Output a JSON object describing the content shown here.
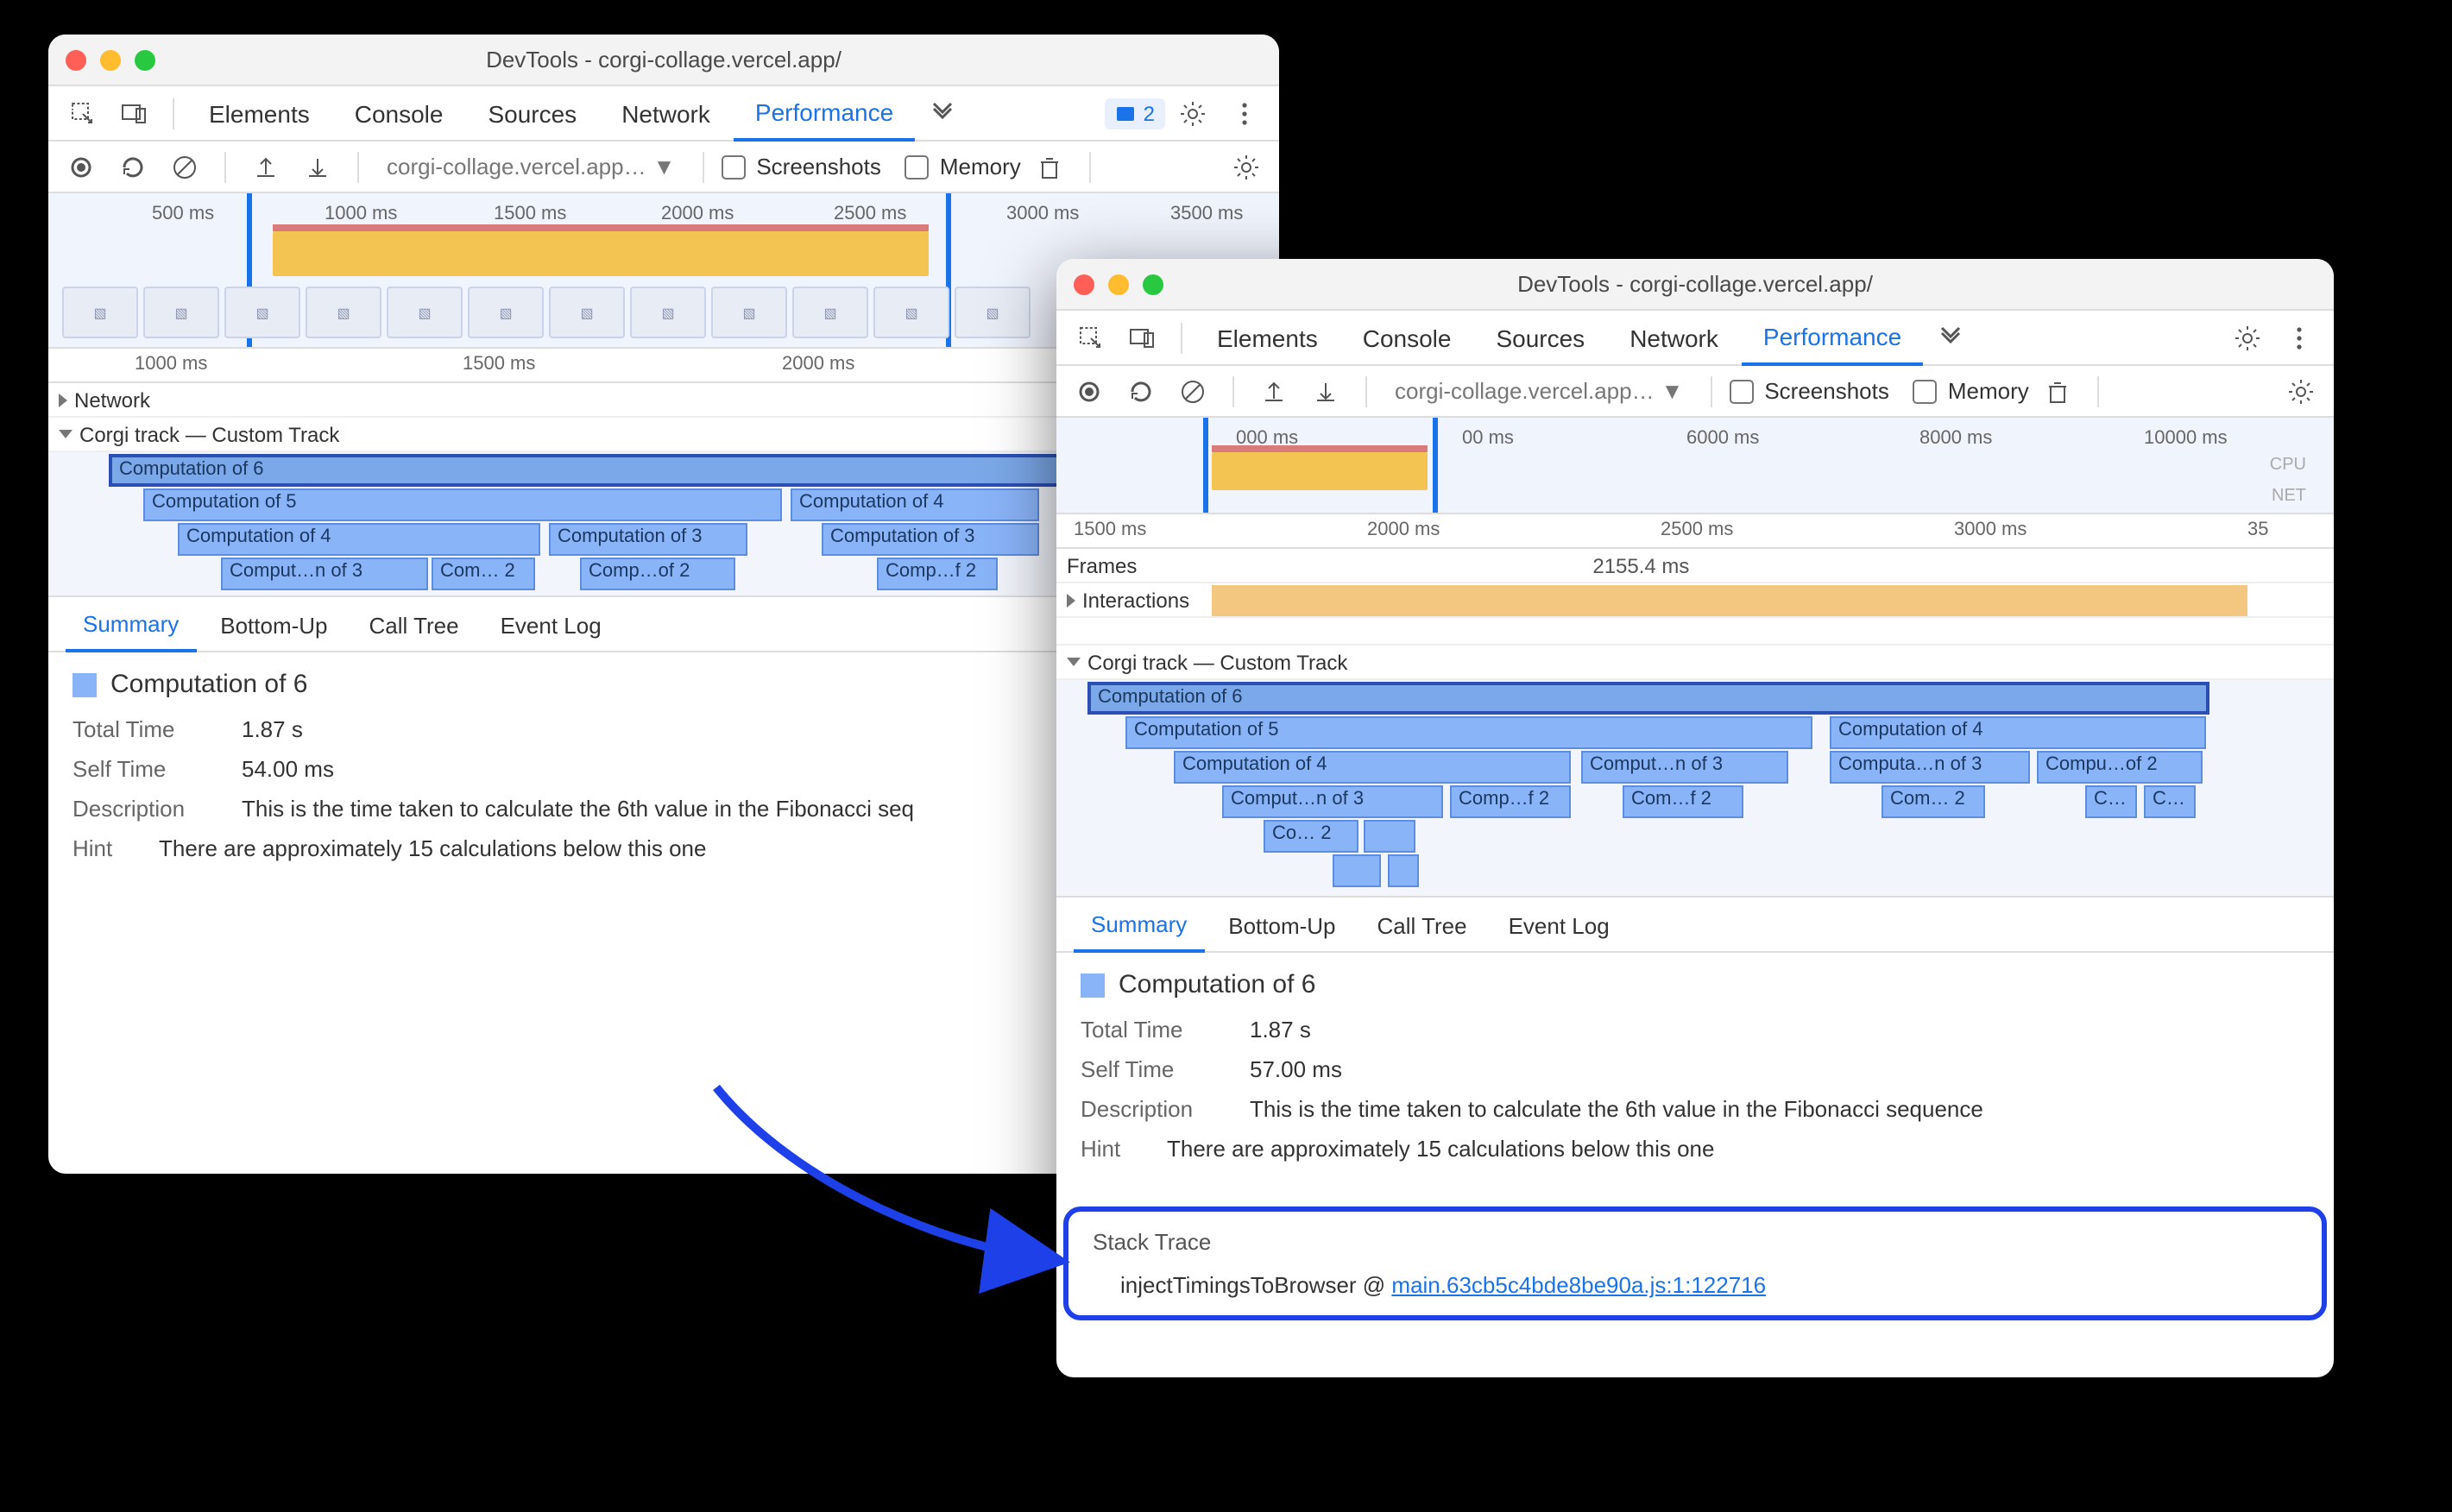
{
  "windowA": {
    "title": "DevTools - corgi-collage.vercel.app/",
    "tabs": [
      "Elements",
      "Console",
      "Sources",
      "Network",
      "Performance"
    ],
    "active_tab": "Performance",
    "issue_count": "2",
    "toolbar": {
      "url_select": "corgi-collage.vercel.app…",
      "screenshots_label": "Screenshots",
      "memory_label": "Memory"
    },
    "overview_ticks": [
      "500 ms",
      "1000 ms",
      "1500 ms",
      "2000 ms",
      "2500 ms",
      "3000 ms",
      "3500 ms"
    ],
    "track_ruler": [
      "1000 ms",
      "1500 ms",
      "2000 ms"
    ],
    "tracks": {
      "network": "Network",
      "corgi": "Corgi track — Custom Track"
    },
    "flames": {
      "r0": "Computation of 6",
      "r1a": "Computation of 5",
      "r1b": "Computation of 4",
      "r2a": "Computation of 4",
      "r2b": "Computation of 3",
      "r2c": "Computation of 3",
      "r3a": "Comput…n of 3",
      "r3b": "Com… 2",
      "r3c": "Comp…of 2",
      "r3d": "Comp…f 2"
    },
    "detail_tabs": [
      "Summary",
      "Bottom-Up",
      "Call Tree",
      "Event Log"
    ],
    "active_detail_tab": "Summary",
    "detail": {
      "title": "Computation of 6",
      "total_time_label": "Total Time",
      "total_time_value": "1.87 s",
      "self_time_label": "Self Time",
      "self_time_value": "54.00 ms",
      "description_label": "Description",
      "description_value": "This is the time taken to calculate the 6th value in the Fibonacci seq",
      "hint_label": "Hint",
      "hint_value": "There are approximately 15 calculations below this one"
    }
  },
  "windowB": {
    "title": "DevTools - corgi-collage.vercel.app/",
    "tabs": [
      "Elements",
      "Console",
      "Sources",
      "Network",
      "Performance"
    ],
    "active_tab": "Performance",
    "toolbar": {
      "url_select": "corgi-collage.vercel.app…",
      "screenshots_label": "Screenshots",
      "memory_label": "Memory"
    },
    "overview_ticks_left": "000 ms",
    "overview_ticks_right": "00 ms",
    "overview_ticks": [
      "6000 ms",
      "8000 ms",
      "10000 ms"
    ],
    "cpu_label": "CPU",
    "net_label": "NET",
    "track_ruler": [
      "1500 ms",
      "2000 ms",
      "2500 ms",
      "3000 ms",
      "35"
    ],
    "frames_label": "Frames",
    "frames_value": "2155.4 ms",
    "interactions_label": "Interactions",
    "tracks": {
      "corgi": "Corgi track — Custom Track"
    },
    "flames": {
      "r0": "Computation of 6",
      "r1a": "Computation of 5",
      "r1b": "Computation of 4",
      "r2a": "Computation of 4",
      "r2b": "Comput…n of 3",
      "r2c": "Computa…n of 3",
      "r2d": "Compu…of 2",
      "r3a": "Comput…n of 3",
      "r3b": "Comp…f 2",
      "r3c": "Com…f 2",
      "r3d": "Com… 2",
      "r3e": "C…",
      "r3f": "C…",
      "r4a": "Co… 2"
    },
    "detail_tabs": [
      "Summary",
      "Bottom-Up",
      "Call Tree",
      "Event Log"
    ],
    "active_detail_tab": "Summary",
    "detail": {
      "title": "Computation of 6",
      "total_time_label": "Total Time",
      "total_time_value": "1.87 s",
      "self_time_label": "Self Time",
      "self_time_value": "57.00 ms",
      "description_label": "Description",
      "description_value": "This is the time taken to calculate the 6th value in the Fibonacci sequence",
      "hint_label": "Hint",
      "hint_value": "There are approximately 15 calculations below this one",
      "stack_trace_label": "Stack Trace",
      "stack_fn": "injectTimingsToBrowser",
      "stack_at": " @ ",
      "stack_link": "main.63cb5c4bde8be90a.js:1:122716"
    }
  }
}
